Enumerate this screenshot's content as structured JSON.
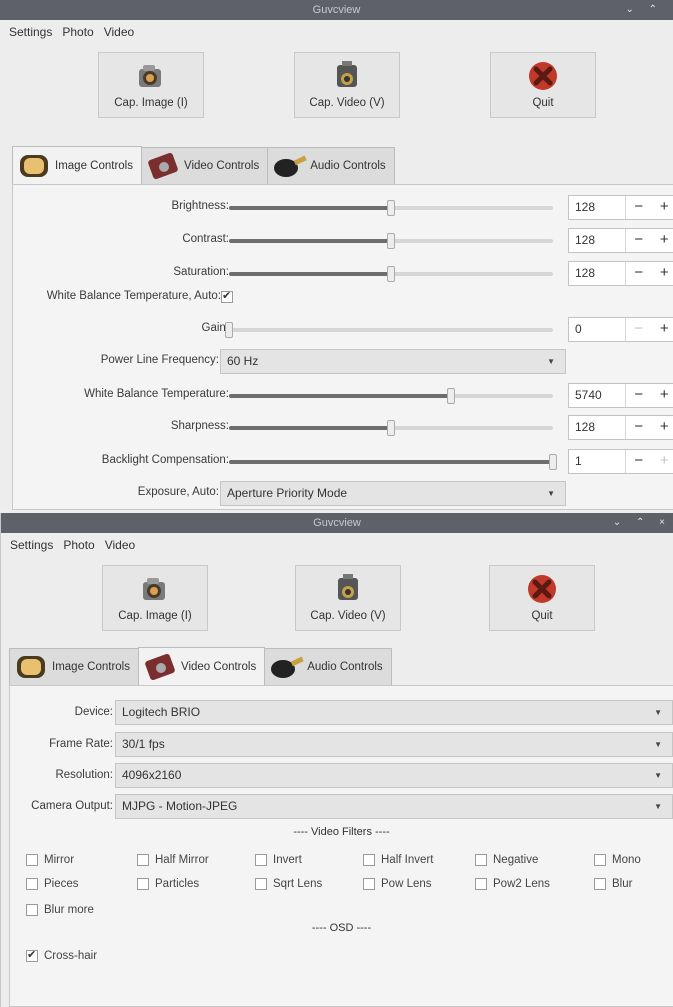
{
  "window1": {
    "title": "Guvcview",
    "window_controls": "⌄ ⌃",
    "menu": [
      "Settings",
      "Photo",
      "Video"
    ],
    "toolbar": {
      "cap_image": "Cap. Image (I)",
      "cap_video": "Cap. Video (V)",
      "quit": "Quit"
    },
    "tabs": [
      "Image Controls",
      "Video Controls",
      "Audio Controls"
    ],
    "active_tab": "Image Controls",
    "controls": {
      "brightness": {
        "label": "Brightness:",
        "value": "128",
        "level": 0.5
      },
      "contrast": {
        "label": "Contrast:",
        "value": "128",
        "level": 0.5
      },
      "saturation": {
        "label": "Saturation:",
        "value": "128",
        "level": 0.5
      },
      "wb_auto": {
        "label": "White Balance Temperature, Auto:",
        "checked": true
      },
      "gain": {
        "label": "Gain:",
        "value": "0",
        "level": 0.0
      },
      "power_line": {
        "label": "Power Line Frequency:",
        "value": "60 Hz"
      },
      "wb_temp": {
        "label": "White Balance Temperature:",
        "value": "5740",
        "level": 0.685
      },
      "sharpness": {
        "label": "Sharpness:",
        "value": "128",
        "level": 0.5
      },
      "backlight": {
        "label": "Backlight Compensation:",
        "value": "1",
        "level": 1.0
      },
      "exposure_auto": {
        "label": "Exposure, Auto:",
        "value": "Aperture Priority Mode"
      }
    },
    "minus": "−",
    "plus": "+"
  },
  "window2": {
    "title": "Guvcview",
    "window_controls": "⌄ ⌃ ×",
    "menu": [
      "Settings",
      "Photo",
      "Video"
    ],
    "toolbar": {
      "cap_image": "Cap. Image (I)",
      "cap_video": "Cap. Video (V)",
      "quit": "Quit"
    },
    "tabs": [
      "Image Controls",
      "Video Controls",
      "Audio Controls"
    ],
    "active_tab": "Video Controls",
    "device": {
      "label": "Device:",
      "value": "Logitech BRIO"
    },
    "frame_rate": {
      "label": "Frame Rate:",
      "value": "30/1 fps"
    },
    "resolution": {
      "label": "Resolution:",
      "value": "4096x2160"
    },
    "camera_output": {
      "label": "Camera Output:",
      "value": "MJPG - Motion-JPEG"
    },
    "video_filters_title": "---- Video Filters ----",
    "filters": [
      {
        "label": "Mirror",
        "checked": false
      },
      {
        "label": "Half Mirror",
        "checked": false
      },
      {
        "label": "Invert",
        "checked": false
      },
      {
        "label": "Half Invert",
        "checked": false
      },
      {
        "label": "Negative",
        "checked": false
      },
      {
        "label": "Mono",
        "checked": false
      },
      {
        "label": "Pieces",
        "checked": false
      },
      {
        "label": "Particles",
        "checked": false
      },
      {
        "label": "Sqrt Lens",
        "checked": false
      },
      {
        "label": "Pow Lens",
        "checked": false
      },
      {
        "label": "Pow2 Lens",
        "checked": false
      },
      {
        "label": "Blur",
        "checked": false
      },
      {
        "label": "Blur more",
        "checked": false
      }
    ],
    "osd_title": "---- OSD ----",
    "osd": [
      {
        "label": "Cross-hair",
        "checked": true
      }
    ]
  },
  "colors": {
    "titlebar": "#5e6167",
    "slider_fill": "#6d6d6d",
    "quit_red": "#c0392b"
  }
}
